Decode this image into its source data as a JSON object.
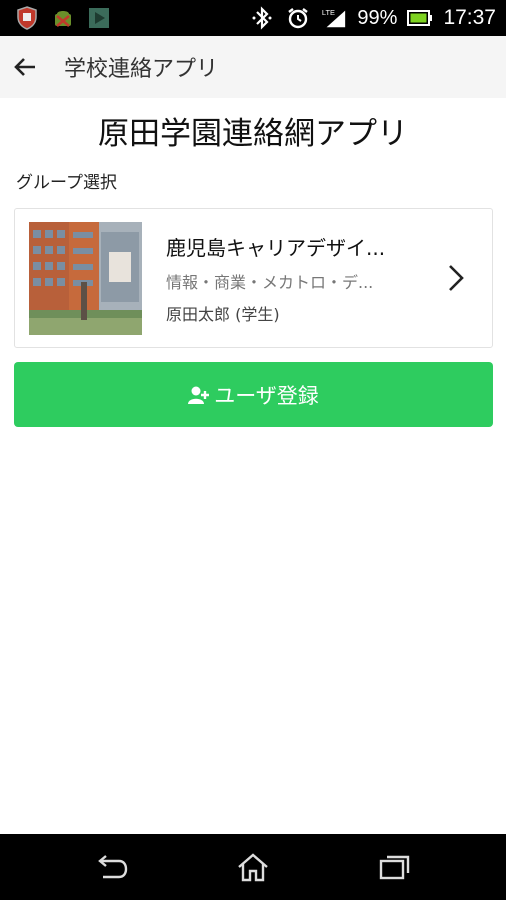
{
  "status_bar": {
    "battery": "99%",
    "time": "17:37",
    "network": "LTE",
    "icons": [
      "shield-icon",
      "android-icon",
      "play-store-icon",
      "bluetooth-icon",
      "alarm-icon",
      "signal-icon",
      "battery-icon"
    ]
  },
  "app_bar": {
    "title": "学校連絡アプリ",
    "back_icon": "arrow-back-icon"
  },
  "page": {
    "title": "原田学園連絡網アプリ",
    "section_label": "グループ選択"
  },
  "group_card": {
    "name": "鹿児島キャリアデザイ...",
    "subtitle": "情報・商業・メカトロ・デ...",
    "user": "原田太郎 (学生)",
    "chevron_icon": "chevron-right-icon",
    "image": "school-building-photo"
  },
  "register_button": {
    "label": "ユーザ登録",
    "icon": "add-user-icon"
  },
  "nav_bar": {
    "icons": [
      "back-nav-icon",
      "home-icon",
      "recents-icon"
    ]
  },
  "colors": {
    "accent": "#2ecc5f",
    "app_bar_bg": "#f5f5f5",
    "status_bar_bg": "#000000"
  }
}
